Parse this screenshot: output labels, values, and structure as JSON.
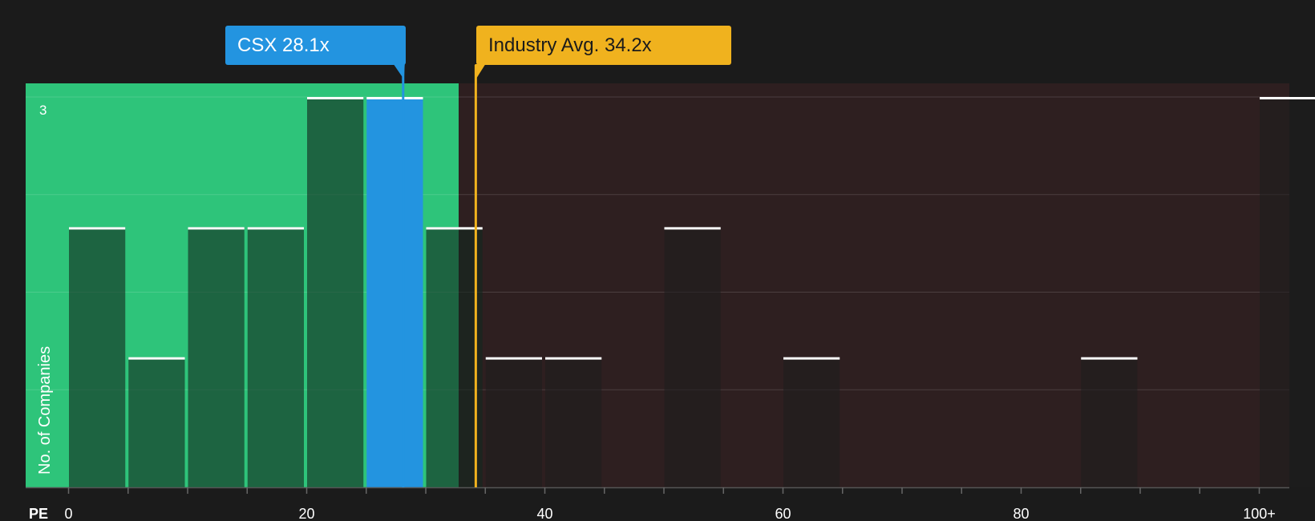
{
  "chart_data": {
    "type": "bar",
    "title": "",
    "xlabel": "PE",
    "ylabel": "No. of Companies",
    "xlim": [
      0,
      106
    ],
    "ylim": [
      0,
      3
    ],
    "y_tick_labels": [
      "3"
    ],
    "x_tick_labels": [
      "0",
      "20",
      "40",
      "60",
      "80",
      "100+"
    ],
    "bin_width": 5,
    "bins": [
      {
        "x_start": 0,
        "count": 2,
        "group": "below-average"
      },
      {
        "x_start": 5,
        "count": 1,
        "group": "below-average"
      },
      {
        "x_start": 10,
        "count": 2,
        "group": "below-average"
      },
      {
        "x_start": 15,
        "count": 2,
        "group": "below-average"
      },
      {
        "x_start": 20,
        "count": 3,
        "group": "below-average"
      },
      {
        "x_start": 25,
        "count": 3,
        "group": "company"
      },
      {
        "x_start": 30,
        "count": 2,
        "group": "below-average"
      },
      {
        "x_start": 35,
        "count": 1,
        "group": "above-average"
      },
      {
        "x_start": 40,
        "count": 1,
        "group": "above-average"
      },
      {
        "x_start": 50,
        "count": 2,
        "group": "above-average"
      },
      {
        "x_start": 60,
        "count": 1,
        "group": "above-average"
      },
      {
        "x_start": 85,
        "count": 1,
        "group": "above-average"
      },
      {
        "x_start": 100,
        "count": 3,
        "group": "above-average"
      }
    ],
    "markers": [
      {
        "name": "company",
        "label": "CSX 28.1x",
        "value": 28.1,
        "color": "#2394e0"
      },
      {
        "name": "industry-avg",
        "label": "Industry Avg. 34.2x",
        "value": 34.2,
        "color": "#f0b21e"
      }
    ],
    "regions": {
      "below_color": "#2ec47a",
      "above_color": "#2e1f20"
    },
    "grid": true,
    "legend": "none"
  }
}
